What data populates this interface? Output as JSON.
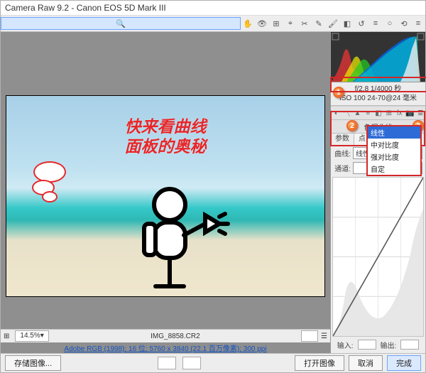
{
  "title": "Camera Raw 9.2  -  Canon EOS 5D Mark III",
  "toolbar": {
    "icons": [
      "🔍",
      "✋",
      "👁",
      "⊞",
      "⌖",
      "✂",
      "✎",
      "🖌",
      "◧",
      "↺",
      "≡",
      "○",
      "⟲",
      "≡"
    ]
  },
  "annot": {
    "line1": "快来看曲线",
    "line2": "面板的奥秘"
  },
  "thumb": {
    "zoom": "14.5%",
    "file": "IMG_8858.CR2",
    "right_u": "☰"
  },
  "info_link": "Adobe RGB (1998); 16 位; 5760 x 3840 (22.1 百万像素); 300 ppi",
  "footer": {
    "save": "存储图像...",
    "open": "打开图像",
    "cancel": "取消",
    "done": "完成"
  },
  "meta": {
    "line1": "f/2.8   1/4000 秒",
    "line2": "ISO 100   24-70@24 毫米"
  },
  "badges": {
    "b1": "1",
    "b2": "2",
    "b3": "3"
  },
  "panel": {
    "title": "色调曲线"
  },
  "subtabs": {
    "a": "参数",
    "b": "点"
  },
  "curve_row": {
    "label": "曲线:",
    "value": "线性"
  },
  "chan_row": {
    "label": "通道:"
  },
  "options": {
    "o0": "线性",
    "o1": "中对比度",
    "o2": "强对比度",
    "o3": "自定"
  },
  "io": {
    "in": "输入:",
    "out": "输出:"
  }
}
